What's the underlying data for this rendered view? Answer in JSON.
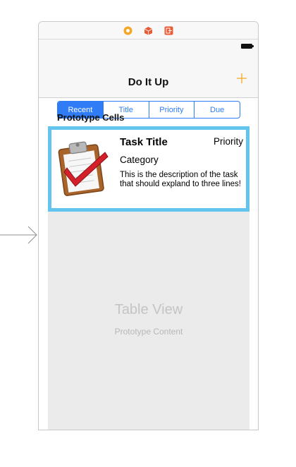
{
  "navigation": {
    "title": "Do It Up",
    "add_icon": "plus-icon"
  },
  "dock": {
    "icons": [
      "view-controller-icon",
      "first-responder-icon",
      "exit-icon"
    ]
  },
  "segments": [
    {
      "label": "Recent",
      "selected": true
    },
    {
      "label": "Title",
      "selected": false
    },
    {
      "label": "Priority",
      "selected": false
    },
    {
      "label": "Due",
      "selected": false
    }
  ],
  "section": {
    "label": "Prototype Cells"
  },
  "cell": {
    "title": "Task Title",
    "priority": "Priority",
    "category": "Category",
    "description": "This is the description of the task that should expland to three lines!",
    "image_icon": "clipboard-checkmark-icon"
  },
  "table_view": {
    "title": "Table View",
    "subtitle": "Prototype Content"
  },
  "colors": {
    "accent": "#2f7cf6",
    "add_button": "#f5a623",
    "cell_selection": "#63c5ee",
    "table_background": "#ebebeb"
  }
}
